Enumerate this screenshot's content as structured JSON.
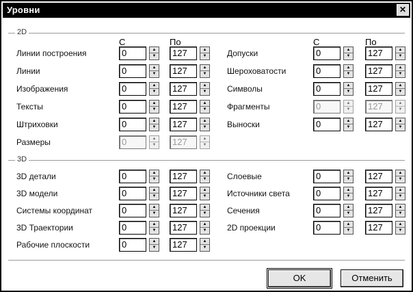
{
  "window": {
    "title": "Уровни",
    "close_glyph": "✕"
  },
  "groups": {
    "g2d": "2D",
    "g3d": "3D"
  },
  "columns": {
    "from": "С",
    "to": "По"
  },
  "rows2d_left": [
    {
      "label": "Линии построения",
      "from": "0",
      "to": "127",
      "disabled": false
    },
    {
      "label": "Линии",
      "from": "0",
      "to": "127",
      "disabled": false
    },
    {
      "label": "Изображения",
      "from": "0",
      "to": "127",
      "disabled": false
    },
    {
      "label": "Тексты",
      "from": "0",
      "to": "127",
      "disabled": false
    },
    {
      "label": "Штриховки",
      "from": "0",
      "to": "127",
      "disabled": false
    },
    {
      "label": "Размеры",
      "from": "0",
      "to": "127",
      "disabled": true
    }
  ],
  "rows2d_right": [
    {
      "label": "Допуски",
      "from": "0",
      "to": "127",
      "disabled": false
    },
    {
      "label": "Шероховатости",
      "from": "0",
      "to": "127",
      "disabled": false
    },
    {
      "label": "Символы",
      "from": "0",
      "to": "127",
      "disabled": false
    },
    {
      "label": "Фрагменты",
      "from": "0",
      "to": "127",
      "disabled": true
    },
    {
      "label": "Выноски",
      "from": "0",
      "to": "127",
      "disabled": false
    }
  ],
  "rows3d_left": [
    {
      "label": "3D детали",
      "from": "0",
      "to": "127",
      "disabled": false
    },
    {
      "label": "3D модели",
      "from": "0",
      "to": "127",
      "disabled": false
    },
    {
      "label": "Системы координат",
      "from": "0",
      "to": "127",
      "disabled": false
    },
    {
      "label": "3D Траектории",
      "from": "0",
      "to": "127",
      "disabled": false
    },
    {
      "label": "Рабочие плоскости",
      "from": "0",
      "to": "127",
      "disabled": false
    }
  ],
  "rows3d_right": [
    {
      "label": "Слоевые",
      "from": "0",
      "to": "127",
      "disabled": false
    },
    {
      "label": "Источники света",
      "from": "0",
      "to": "127",
      "disabled": false
    },
    {
      "label": "Сечения",
      "from": "0",
      "to": "127",
      "disabled": false
    },
    {
      "label": "2D проекции",
      "from": "0",
      "to": "127",
      "disabled": false
    }
  ],
  "buttons": {
    "ok": "OK",
    "cancel": "Отменить"
  }
}
